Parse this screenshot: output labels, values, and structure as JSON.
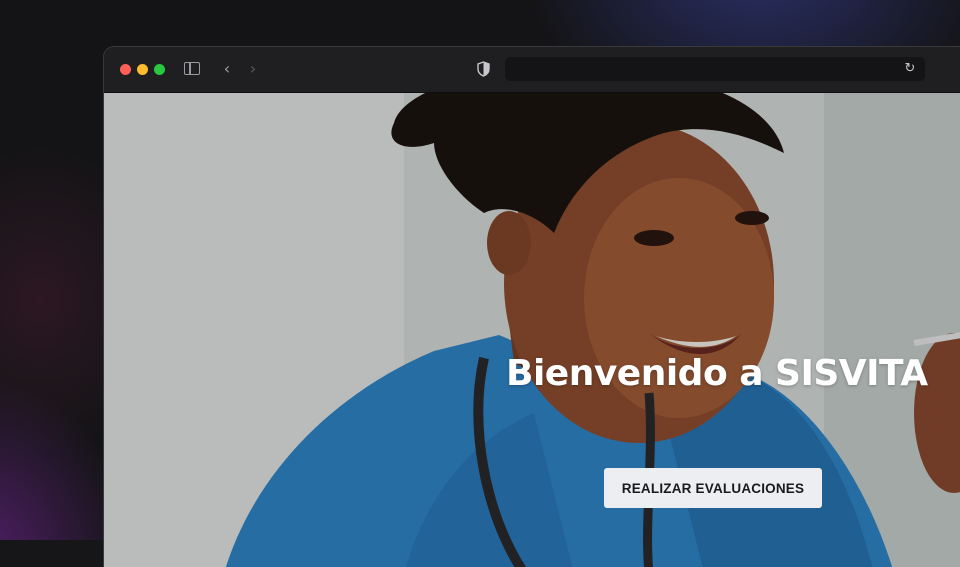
{
  "browser": {
    "window_controls": [
      "close",
      "minimize",
      "zoom"
    ],
    "toolbar_icons": {
      "sidebar": "sidebar-icon",
      "back": "chevron-left-icon",
      "forward": "chevron-right-icon",
      "privacy": "shield-icon",
      "reload": "reload-icon"
    },
    "address": "",
    "colors": {
      "close": "#fe5f57",
      "minimize": "#febc2e",
      "zoom": "#28c840"
    }
  },
  "hero": {
    "image": "smiling nurse in blue scrubs with stethoscope",
    "title": "Bienvenido a SISVITA",
    "cta_label": "REALIZAR EVALUACIONES"
  }
}
